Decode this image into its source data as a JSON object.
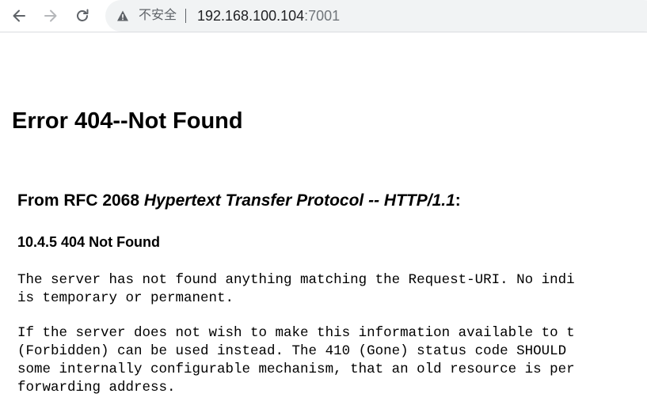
{
  "browser": {
    "security_label": "不安全",
    "url_host": "192.168.100.104",
    "url_port": ":7001"
  },
  "page": {
    "title": "Error 404--Not Found",
    "rfc_prefix": "From RFC 2068 ",
    "rfc_title": "Hypertext Transfer Protocol -- HTTP/1.1",
    "rfc_suffix": ":",
    "section": "10.4.5 404 Not Found",
    "paragraph1": "The server has not found anything matching the Request-URI. No indi\nis temporary or permanent.",
    "paragraph2": "If the server does not wish to make this information available to t\n(Forbidden) can be used instead. The 410 (Gone) status code SHOULD\nsome internally configurable mechanism, that an old resource is per\nforwarding address."
  },
  "icons": {
    "back": "arrow-left-icon",
    "forward": "arrow-right-icon",
    "reload": "reload-icon",
    "security": "warning-triangle-icon"
  },
  "colors": {
    "omnibox_bg": "#f1f3f4",
    "active_icon": "#5f6368",
    "disabled_icon": "#b5b7ba"
  }
}
